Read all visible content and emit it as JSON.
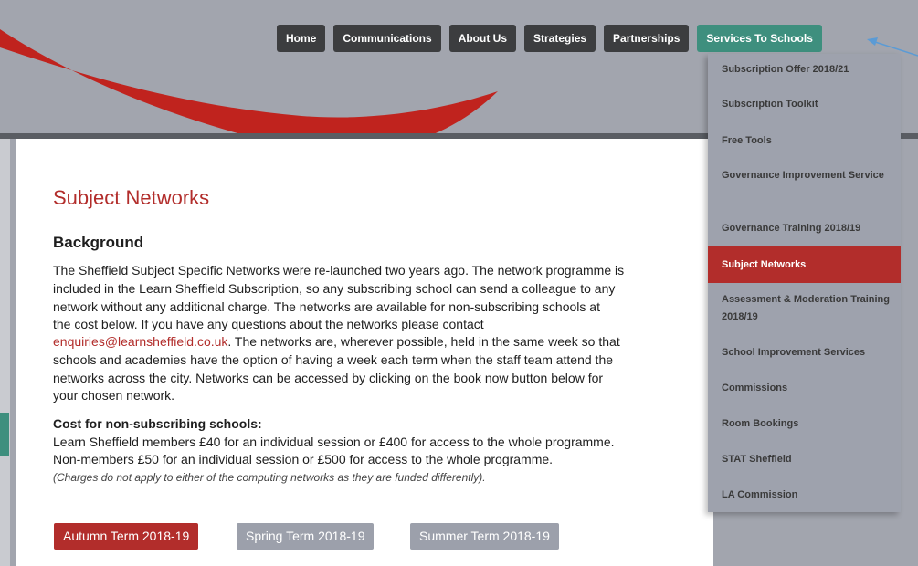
{
  "colors": {
    "accent_red": "#b22d2b",
    "accent_teal": "#3e8f7e",
    "nav_dark": "#3c3d3f",
    "header_grey": "#a2a5ae"
  },
  "nav": {
    "items": [
      {
        "label": "Home"
      },
      {
        "label": "Communications"
      },
      {
        "label": "About Us"
      },
      {
        "label": "Strategies"
      },
      {
        "label": "Partnerships"
      },
      {
        "label": "Services To Schools",
        "active": true
      }
    ]
  },
  "dropdown": {
    "items": [
      {
        "label": "Subscription Offer 2018/21"
      },
      {
        "label": "Subscription Toolkit"
      },
      {
        "label": "Free Tools"
      },
      {
        "label": "Governance Improvement Service"
      },
      {
        "label": "Governance Training 2018/19"
      },
      {
        "label": "Subject Networks",
        "active": true
      },
      {
        "label": "Assessment & Moderation Training 2018/19"
      },
      {
        "label": "School Improvement Services"
      },
      {
        "label": "Commissions"
      },
      {
        "label": "Room Bookings"
      },
      {
        "label": "STAT Sheffield"
      },
      {
        "label": "LA Commission"
      }
    ]
  },
  "main": {
    "title": "Subject Networks",
    "background_heading": "Background",
    "background_lines": [
      "The Sheffield Subject Specific Networks were re-launched two years ago. The network programme is",
      "included in the Learn Sheffield Subscription, so any subscribing school can send a colleague to any",
      "network without any additional charge. The networks are available for non-subscribing schools at",
      "the cost below. If you have any questions about the networks please contact",
      "schools and academies have the option of having a week each term when the staff team attend the",
      "networks across the city. Networks can be accessed by clicking on the book now button below for",
      "your chosen network."
    ],
    "email_link": "enquiries@learnsheffield.co.uk",
    "email_suffix": ". The networks are, wherever possible, held in the same week so that",
    "cost_heading": "Cost for non-subscribing schools:",
    "cost_lines": [
      "Learn Sheffield members £40 for an individual session or £400 for access to the whole programme.",
      "Non-members £50 for an individual session or £500 for access to the whole programme."
    ],
    "charges_note": "(Charges do not apply to either of the computing networks as they are funded differently).",
    "terms": [
      {
        "label": "Autumn Term 2018-19",
        "active": true
      },
      {
        "label": "Spring Term 2018-19"
      },
      {
        "label": "Summer Term 2018-19"
      }
    ]
  },
  "icons": {
    "header_decoration": "red-swoosh",
    "pointer": "arrow-icon"
  }
}
